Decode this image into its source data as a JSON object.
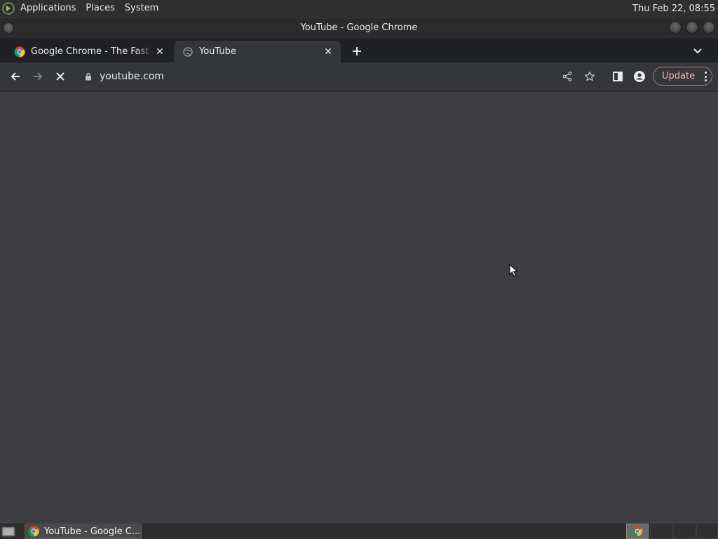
{
  "top_panel": {
    "menus": [
      "Applications",
      "Places",
      "System"
    ],
    "clock": "Thu Feb 22, 08:55"
  },
  "window": {
    "title": "YouTube - Google Chrome"
  },
  "tabs": [
    {
      "title": "Google Chrome - The Fast & Secure",
      "favicon": "chrome-icon",
      "active": false
    },
    {
      "title": "YouTube",
      "favicon": "globe-icon",
      "active": true,
      "loading": true
    }
  ],
  "toolbar": {
    "url": "youtube.com",
    "update_label": "Update"
  },
  "taskbar": {
    "window_button": "YouTube - Google C..."
  },
  "colors": {
    "content_bg": "#3e3e42",
    "toolbar_bg": "#35363a",
    "tabstrip_bg": "#202124",
    "update_text": "#f2b8b5"
  }
}
